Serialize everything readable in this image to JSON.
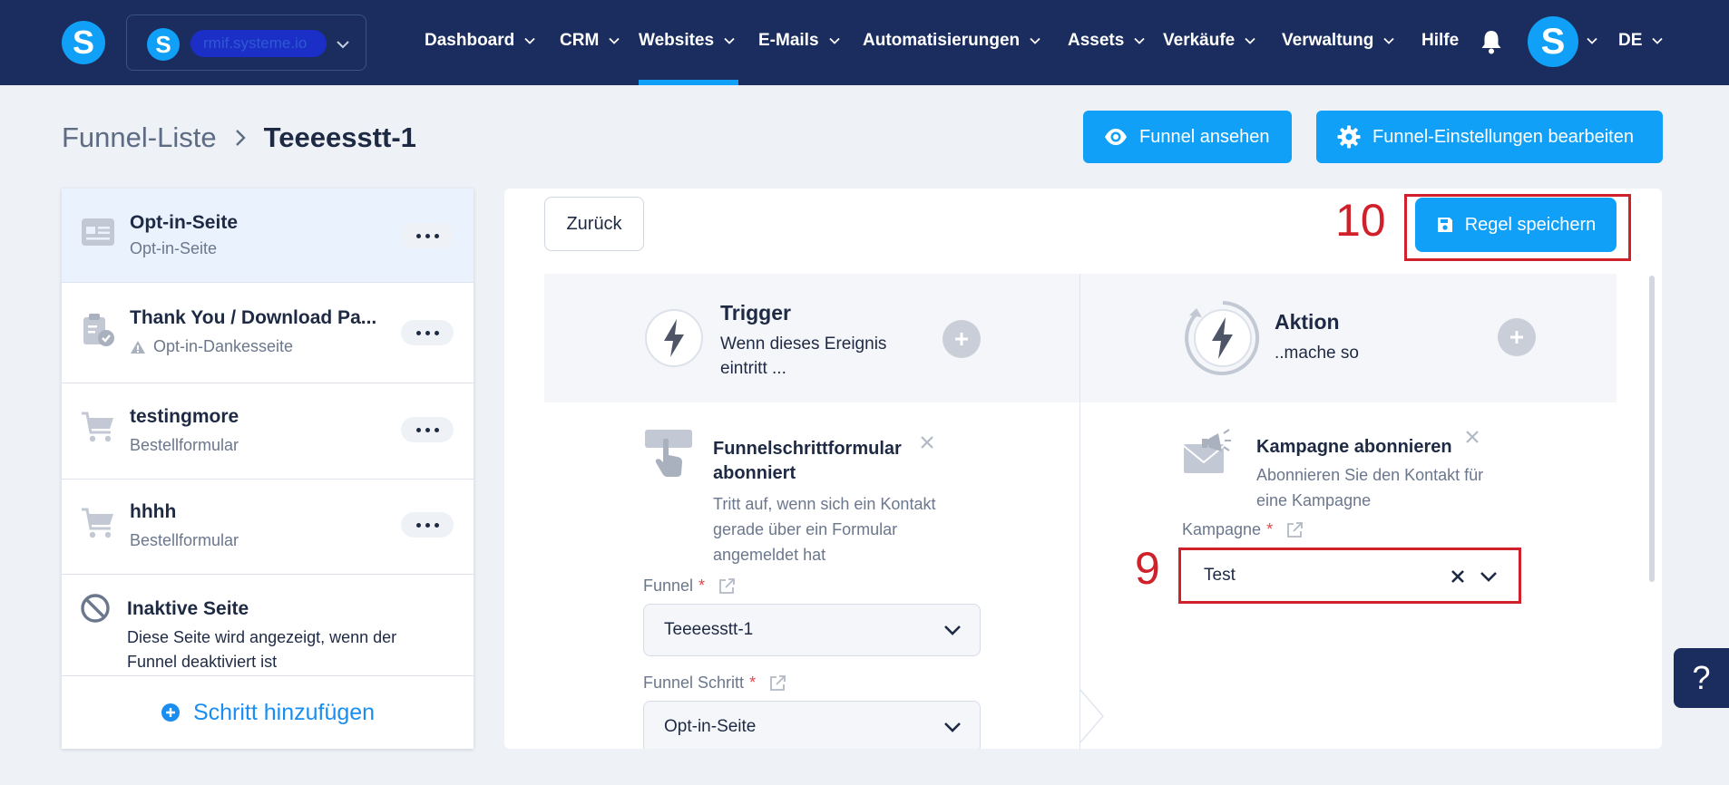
{
  "nav": {
    "workspace_name": "rmif.systeme.io",
    "items": [
      {
        "label": "Dashboard"
      },
      {
        "label": "CRM"
      },
      {
        "label": "Websites"
      },
      {
        "label": "E-Mails"
      },
      {
        "label": "Automatisierungen"
      },
      {
        "label": "Assets"
      },
      {
        "label": "Verkäufe"
      },
      {
        "label": "Verwaltung"
      },
      {
        "label": "Hilfe"
      }
    ],
    "active": "Websites",
    "language": "DE",
    "logo_letter": "S"
  },
  "breadcrumb": {
    "parent": "Funnel-Liste",
    "current": "Teeeesstt-1"
  },
  "header_buttons": {
    "view": "Funnel ansehen",
    "settings": "Funnel-Einstellungen bearbeiten"
  },
  "sidebar": {
    "steps": [
      {
        "title": "Opt-in-Seite",
        "subtitle": "Opt-in-Seite",
        "icon": "page-icon",
        "active": true
      },
      {
        "title": "Thank You / Download Pa...",
        "subtitle": "Opt-in-Dankesseite",
        "icon": "clipboard-check-icon",
        "warning": true
      },
      {
        "title": "testingmore",
        "subtitle": "Bestellformular",
        "icon": "cart-icon"
      },
      {
        "title": "hhhh",
        "subtitle": "Bestellformular",
        "icon": "cart-icon"
      }
    ],
    "inactive": {
      "title": "Inaktive Seite",
      "description": "Diese Seite wird angezeigt, wenn der Funnel deaktiviert ist"
    },
    "add_step": "Schritt hinzufügen"
  },
  "main": {
    "back": "Zurück",
    "save": "Regel speichern",
    "annotation_save": "10",
    "annotation_campaign": "9",
    "trigger": {
      "title": "Trigger",
      "description": "Wenn dieses Ereignis eintritt ...",
      "card_title": "Funnelschrittformular abonniert",
      "card_desc": "Tritt auf, wenn sich ein Kontakt gerade über ein Formular angemeldet hat",
      "funnel_label": "Funnel",
      "funnel_value": "Teeeesstt-1",
      "step_label": "Funnel Schritt",
      "step_value": "Opt-in-Seite"
    },
    "action": {
      "title": "Aktion",
      "description": "..mache so",
      "card_title": "Kampagne abonnieren",
      "card_desc": "Abonnieren Sie den Kontakt für eine Kampagne",
      "campaign_label": "Kampagne",
      "campaign_value": "Test"
    },
    "required_mark": "*"
  },
  "help": "?",
  "colors": {
    "nav_bg": "#1a2d5e",
    "accent": "#10a0f7",
    "annotation": "#d0202a",
    "page_bg": "#eef1f6"
  }
}
